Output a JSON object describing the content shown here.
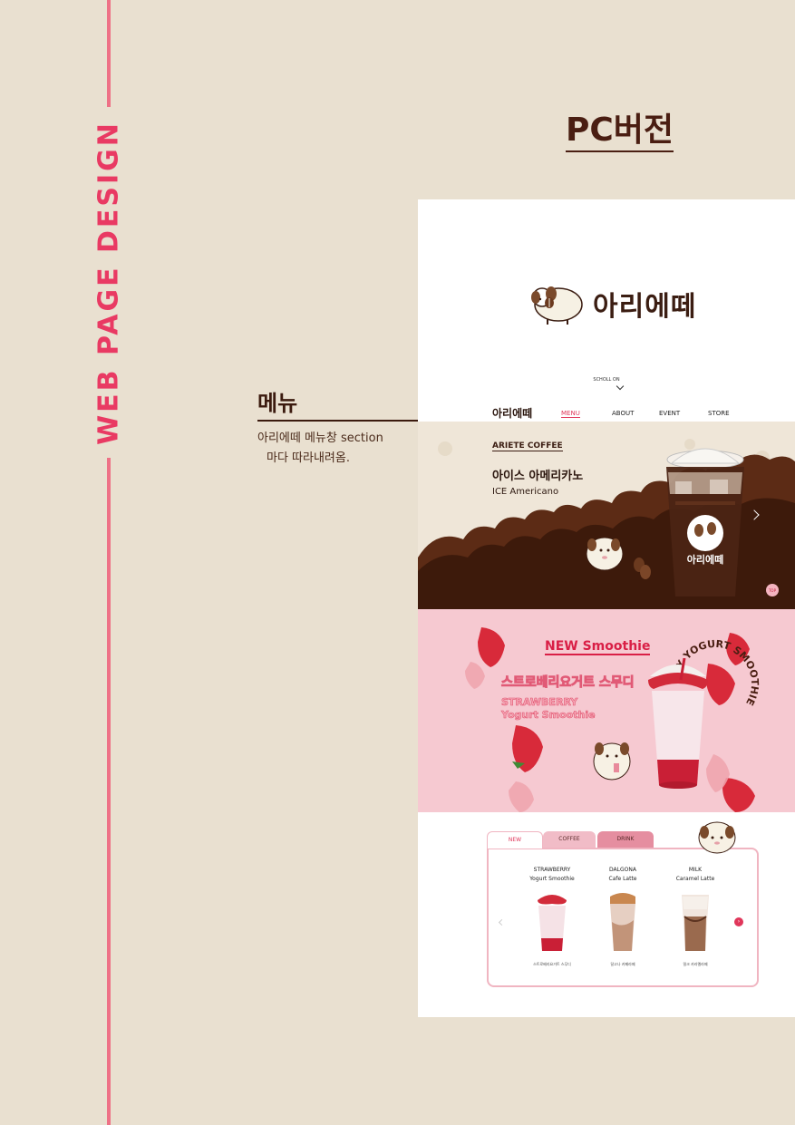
{
  "page": {
    "vertical_title": "WEB PAGE DESIGN",
    "pc_title": "PC버전",
    "section_label": "메뉴",
    "description": [
      "아리에떼 메뉴창 section",
      "마다 따라내려옴."
    ]
  },
  "site": {
    "logo_text": "아리에떼",
    "scroll_hint": "SCHOLL ON",
    "nav": {
      "logo": "아리에떼",
      "items": [
        "MENU",
        "ABOUT",
        "EVENT",
        "STORE"
      ],
      "active": "MENU"
    },
    "hero": {
      "sub": "ARIETE COFFEE",
      "title": "아이스 아메리카노",
      "english": "ICE Americano",
      "cup_logo": "아리에떼",
      "top_button": "TOP"
    },
    "smoothie": {
      "badge": "NEW Smoothie",
      "korean": "스트로베리요거트 스무디",
      "english_line1": "STRAWBERRY",
      "english_line2": "Yogurt Smoothie",
      "circle_text": "RRY YOGURT SMOOTHIE"
    },
    "menu_tabs": {
      "tabs": [
        "NEW",
        "COFFEE",
        "DRINK"
      ],
      "products": [
        {
          "line1": "STRAWBERRY",
          "line2": "Yogurt Smoothie",
          "korean": "스트로베리요거트 스무디"
        },
        {
          "line1": "DALGONA",
          "line2": "Cafe Latte",
          "korean": "달고나 카페라떼"
        },
        {
          "line1": "MILK",
          "line2": "Caramel Latte",
          "korean": "밀크 카라멜라떼"
        }
      ]
    }
  },
  "colors": {
    "background": "#e9e0d0",
    "accent_pink": "#e93a63",
    "brown": "#3b1d12",
    "smoothie_bg": "#f6c9d1"
  }
}
